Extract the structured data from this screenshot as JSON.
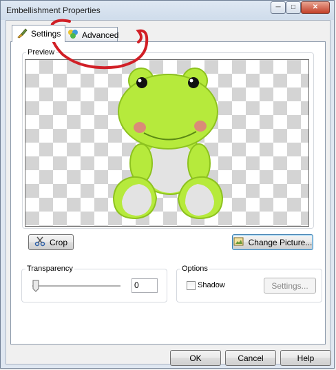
{
  "window": {
    "title": "Embellishment Properties",
    "caption_buttons": {
      "minimize": "─",
      "maximize": "□",
      "close": "✕"
    }
  },
  "tabs": [
    {
      "label": "Settings",
      "icon": "brush-icon",
      "selected": true
    },
    {
      "label": "Advanced",
      "icon": "color-balls-icon",
      "selected": false
    }
  ],
  "preview": {
    "label": "Preview",
    "image": "frog-embellishment"
  },
  "buttons": {
    "crop": "Crop",
    "change_picture": "Change Picture...",
    "settings": "Settings...",
    "ok": "OK",
    "cancel": "Cancel",
    "help": "Help"
  },
  "transparency": {
    "label": "Transparency",
    "value": "0",
    "level": 0
  },
  "options": {
    "label": "Options",
    "shadow_label": "Shadow",
    "shadow_checked": false
  },
  "colors": {
    "annotation": "#d11f26",
    "frog_green": "#b6ea3c",
    "frog_belly": "#e3e3e3"
  }
}
